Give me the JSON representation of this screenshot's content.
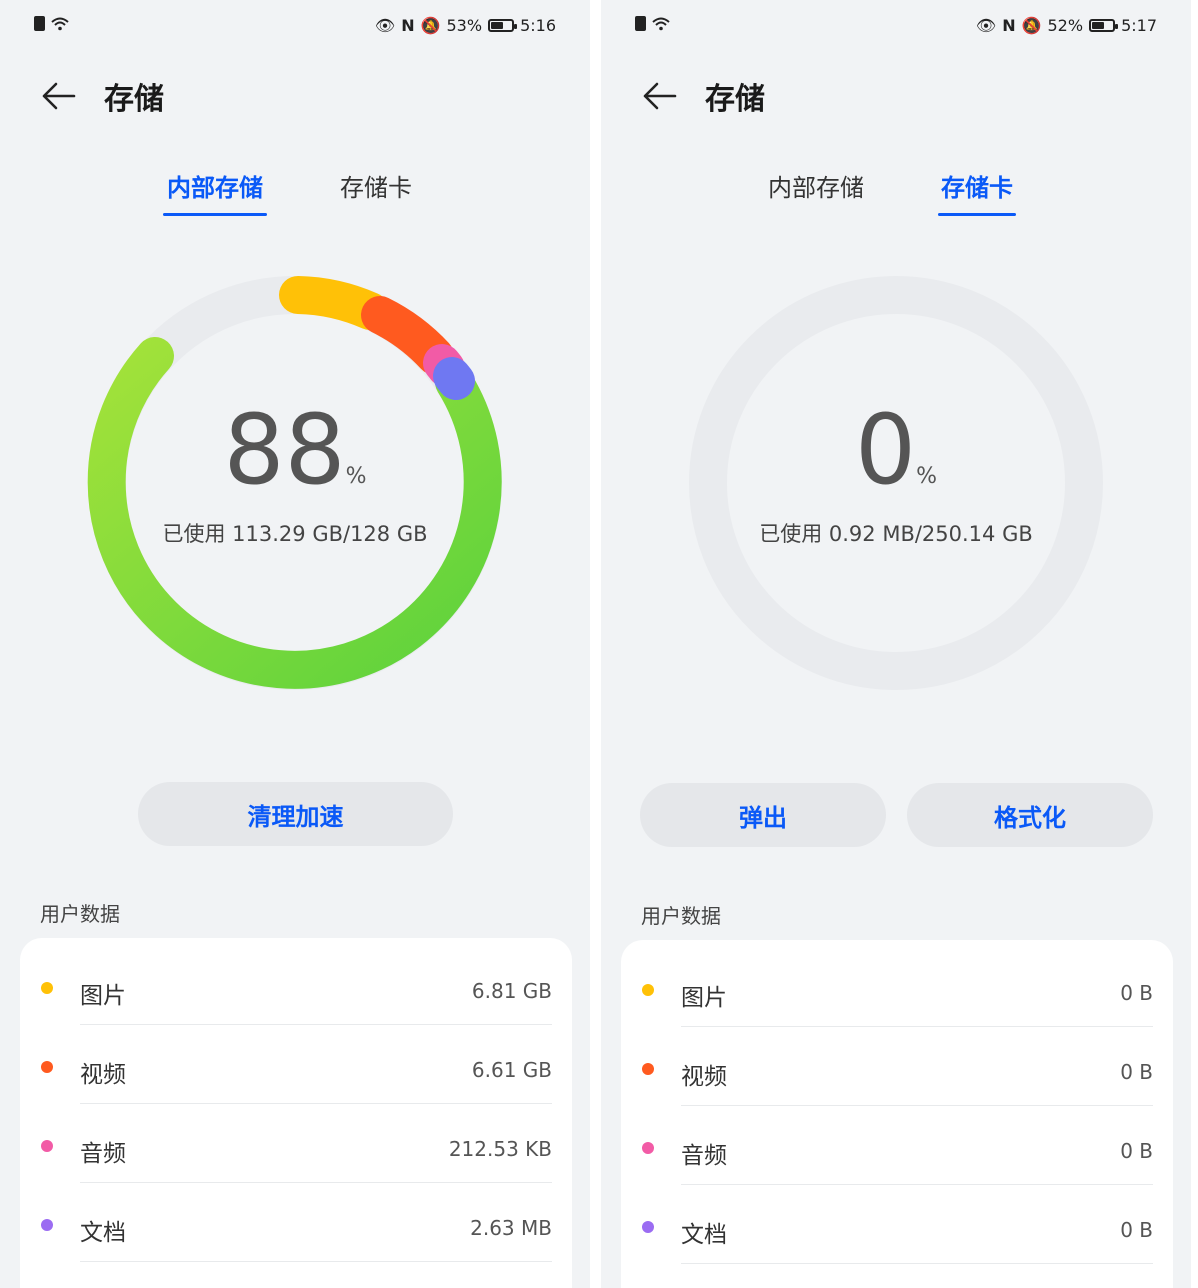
{
  "colors": {
    "accent": "#0a59f7",
    "images": "#ffc107",
    "videos": "#ff5a1f",
    "audio": "#f25ba6",
    "documents": "#9b6cf2",
    "other_apps": "#6dd23a",
    "track": "#e9ebee"
  },
  "screens": [
    {
      "status": {
        "battery_pct": "53%",
        "time": "5:16",
        "battery_level": 0.53
      },
      "title": "存储",
      "tabs": [
        "内部存储",
        "存储卡"
      ],
      "active_tab": 0,
      "usage": {
        "percent": "88",
        "percent_sign": "%",
        "used_text": "已使用 113.29 GB/128 GB",
        "fraction": 0.88
      },
      "buttons": [
        "清理加速"
      ],
      "section_label": "用户数据",
      "items": [
        {
          "label": "图片",
          "value": "6.81 GB",
          "color": "#ffc107"
        },
        {
          "label": "视频",
          "value": "6.61 GB",
          "color": "#ff5a1f"
        },
        {
          "label": "音频",
          "value": "212.53 KB",
          "color": "#f25ba6"
        },
        {
          "label": "文档",
          "value": "2.63 MB",
          "color": "#9b6cf2"
        }
      ]
    },
    {
      "status": {
        "battery_pct": "52%",
        "time": "5:17",
        "battery_level": 0.52
      },
      "title": "存储",
      "tabs": [
        "内部存储",
        "存储卡"
      ],
      "active_tab": 1,
      "usage": {
        "percent": "0",
        "percent_sign": "%",
        "used_text": "已使用 0.92 MB/250.14 GB",
        "fraction": 0.0
      },
      "buttons": [
        "弹出",
        "格式化"
      ],
      "section_label": "用户数据",
      "items": [
        {
          "label": "图片",
          "value": "0 B",
          "color": "#ffc107"
        },
        {
          "label": "视频",
          "value": "0 B",
          "color": "#ff5a1f"
        },
        {
          "label": "音频",
          "value": "0 B",
          "color": "#f25ba6"
        },
        {
          "label": "文档",
          "value": "0 B",
          "color": "#9b6cf2"
        }
      ]
    }
  ]
}
